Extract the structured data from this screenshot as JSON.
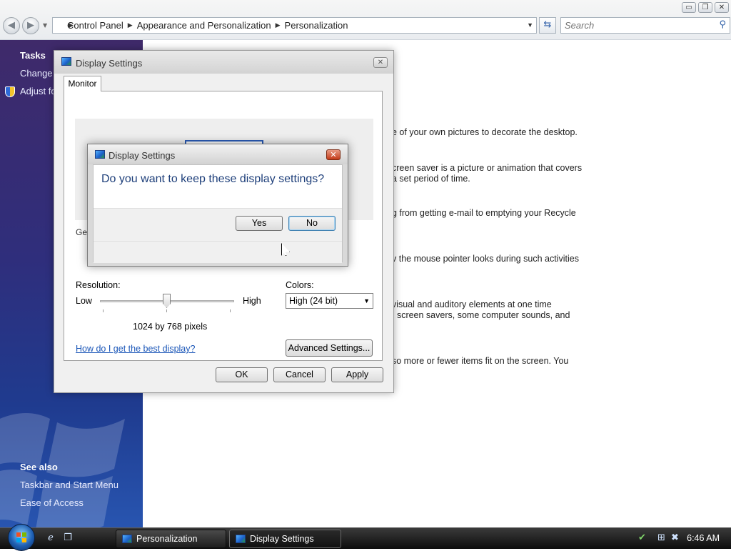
{
  "explorer": {
    "breadcrumb": [
      "Control Panel",
      "Appearance and Personalization",
      "Personalization"
    ],
    "search_placeholder": "Search",
    "window_controls": {
      "minimize": "▭",
      "restore": "❐",
      "close": "✕"
    }
  },
  "left_pane": {
    "tasks_title": "Tasks",
    "tasks": [
      "Change d",
      "Adjust fo"
    ],
    "see_also_title": "See also",
    "see_also": [
      "Taskbar and Start Menu",
      "Ease of Access"
    ]
  },
  "descriptions": [
    "e of your own pictures to decorate the desktop.",
    "creen saver is a picture or animation that covers",
    "a set period of time.",
    "g from getting e-mail to emptying your Recycle",
    "v the mouse pointer looks during such activities",
    "visual and auditory elements at one time",
    ", screen savers, some computer sounds, and",
    " so more or fewer items fit on the screen. You"
  ],
  "display_settings": {
    "title": "Display Settings",
    "tab": "Monitor",
    "general_label": "Ger",
    "resolution_label": "Resolution:",
    "low_label": "Low",
    "high_label": "High",
    "resolution_value": "1024 by 768 pixels",
    "colors_label": "Colors:",
    "colors_value": "High (24 bit)",
    "help_link": "How do I get the best display?",
    "advanced_button": "Advanced Settings...",
    "ok_button": "OK",
    "cancel_button": "Cancel",
    "apply_button": "Apply"
  },
  "confirm_dialog": {
    "title": "Display Settings",
    "question": "Do you want to keep these display settings?",
    "yes_button": "Yes",
    "no_button": "No"
  },
  "taskbar": {
    "buttons": [
      {
        "label": "Personalization",
        "active": false
      },
      {
        "label": "Display Settings",
        "active": true
      }
    ],
    "clock": "6:46 AM"
  }
}
